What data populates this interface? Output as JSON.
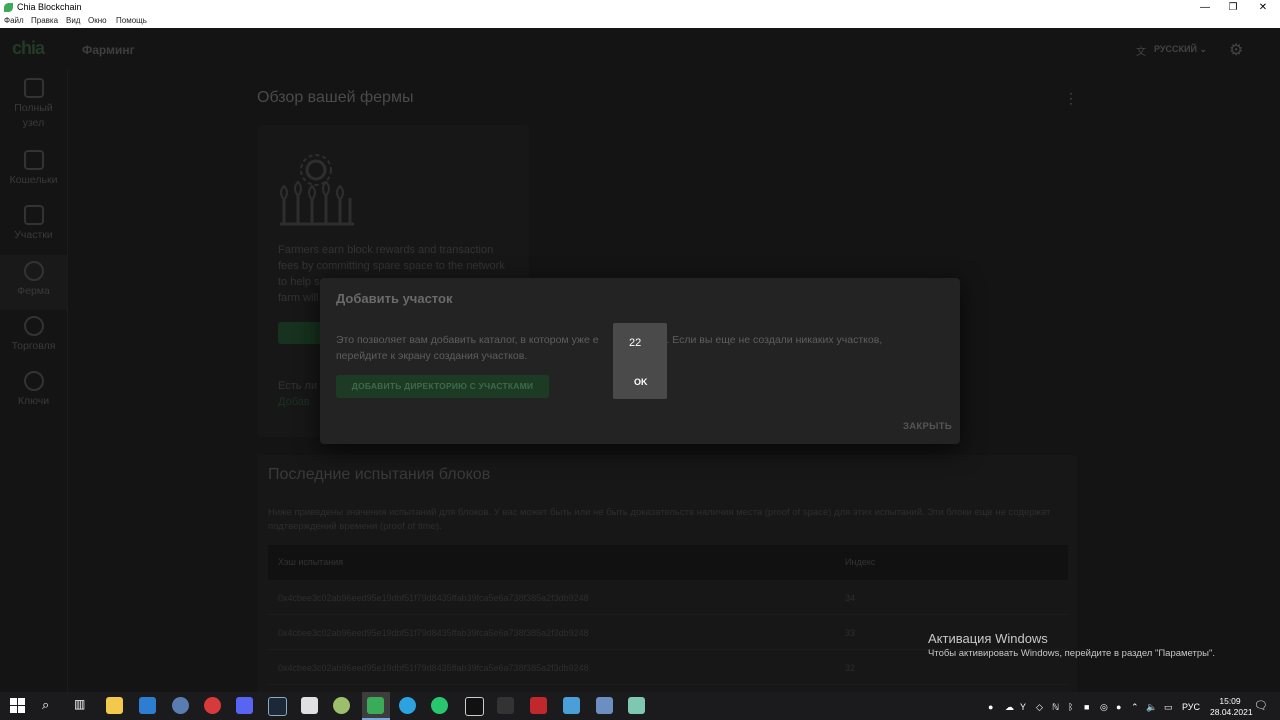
{
  "window": {
    "title": "Chia Blockchain",
    "controls": [
      "—",
      "❐",
      "✕"
    ]
  },
  "menu": [
    "Файл",
    "Правка",
    "Вид",
    "Окно",
    "Помощь"
  ],
  "header": {
    "logo": "chia",
    "page_title": "Фарминг",
    "language": "РУССКИЙ"
  },
  "sidebar": {
    "items": [
      {
        "label_line1": "Полный",
        "label_line2": "узел"
      },
      {
        "label_line1": "Кошельки"
      },
      {
        "label_line1": "Участки"
      },
      {
        "label_line1": "Ферма"
      },
      {
        "label_line1": "Торговля"
      },
      {
        "label_line1": "Ключи"
      }
    ]
  },
  "main": {
    "heading": "Обзор вашей фермы",
    "farm_card": {
      "text_l1": "Farmers earn block rewards and transaction",
      "text_l2": "fees by committing spare space to the network",
      "text_l3": "to help s",
      "text_l4": "farm will",
      "question": "Есть ли",
      "link": "Добав"
    },
    "challenges": {
      "title": "Последние испытания блоков",
      "desc": "Ниже приведены значения испытаний для блоков. У вас может быть или не быть доказательств наличия места (proof of space) для этих испытаний. Эти блоки еще не содержат подтверждений времени (proof of time).",
      "col_hash": "Хэш испытания",
      "col_index": "Индекс",
      "rows": [
        {
          "hash": "0x4cbee3c02ab96eed95e19dbf51f79d8435ffab39fca5e6a738f385a2f3db9248",
          "index": "34"
        },
        {
          "hash": "0x4cbee3c02ab96eed95e19dbf51f79d8435ffab39fca5e6a738f385a2f3db9248",
          "index": "33"
        },
        {
          "hash": "0x4cbee3c02ab96eed95e19dbf51f79d8435ffab39fca5e6a738f385a2f3db9248",
          "index": "32"
        }
      ]
    }
  },
  "dialog": {
    "title": "Добавить участок",
    "body_l1": "Это позволяет вам добавить каталог, в котором уже е",
    "body_l1_tail": "и. Если вы еще не создали никаких участков,",
    "body_l2": "перейдите к экрану создания участков.",
    "add_button": "ДОБАВИТЬ ДИРЕКТОРИЮ С УЧАСТКАМИ",
    "close_button": "ЗАКРЫТЬ"
  },
  "alert": {
    "message": "22",
    "ok": "OK"
  },
  "activation": {
    "title": "Активация Windows",
    "subtitle": "Чтобы активировать Windows, перейдите в раздел \"Параметры\"."
  },
  "taskbar": {
    "lang": "РУС",
    "time": "15:09",
    "date": "28.04.2021"
  }
}
